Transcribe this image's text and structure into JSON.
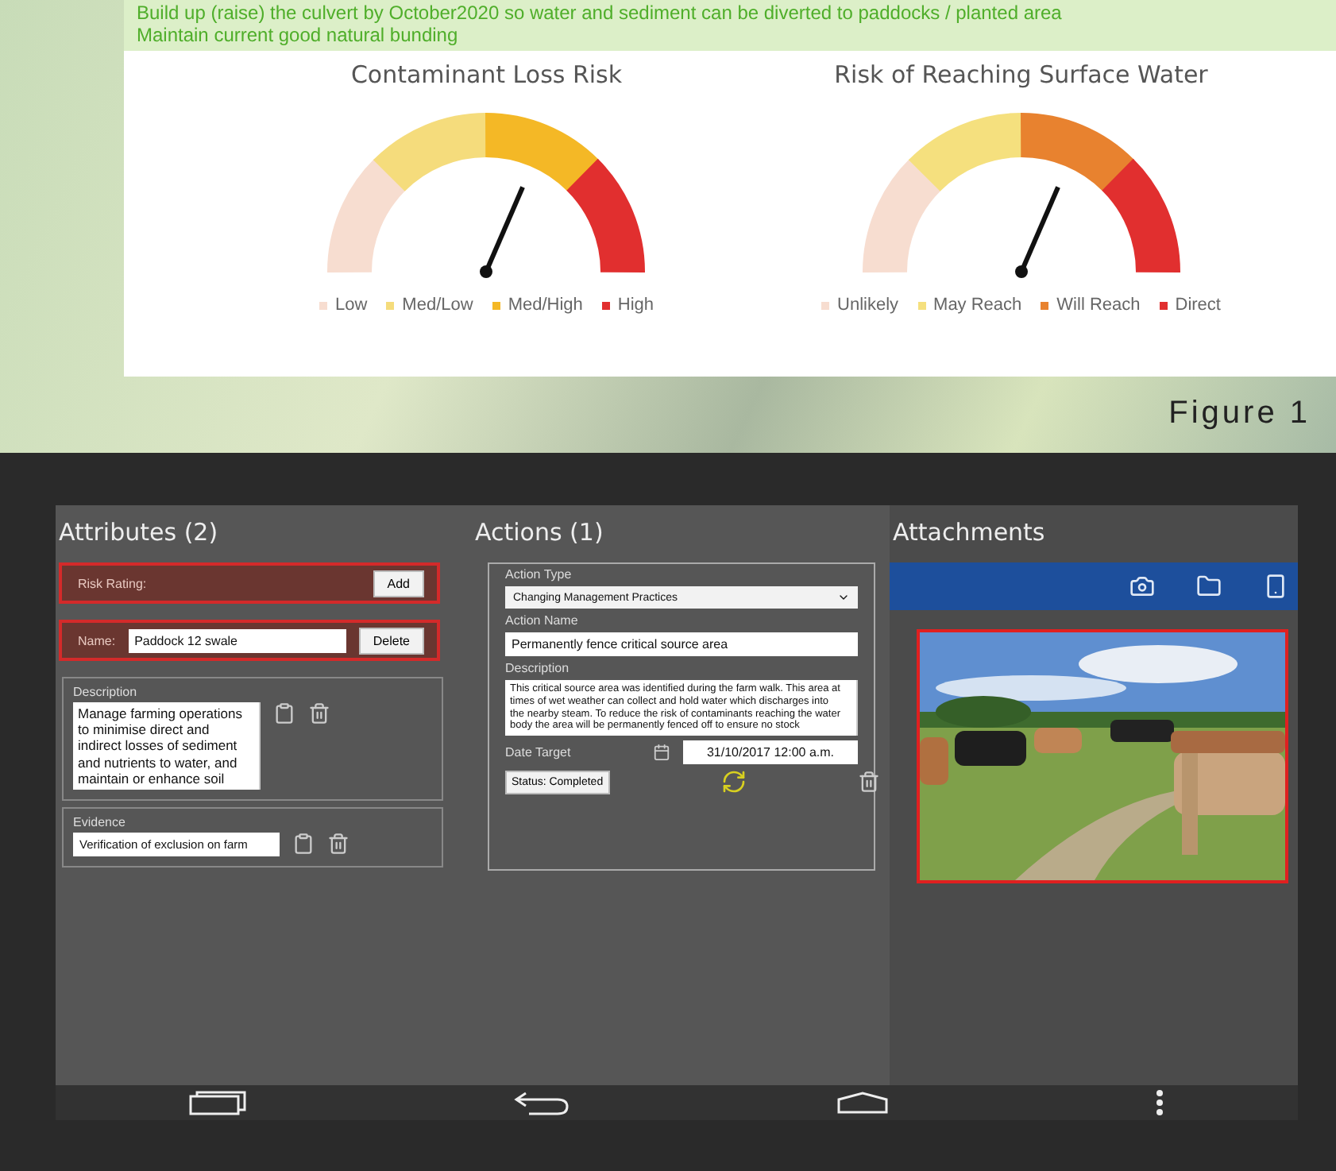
{
  "note": {
    "lines": [
      "Build up (raise) the culvert by October2020 so water and sediment can be diverted to paddocks / planted area",
      "Maintain current good natural bunding"
    ]
  },
  "gauges": [
    {
      "title": "Contaminant Loss Risk",
      "legend": [
        {
          "label": "Low",
          "color": "#f7ddd0"
        },
        {
          "label": "Med/Low",
          "color": "#f5dc7c"
        },
        {
          "label": "Med/High",
          "color": "#f4b826"
        },
        {
          "label": "High",
          "color": "#e12f2f"
        }
      ]
    },
    {
      "title": "Risk of Reaching Surface Water",
      "legend": [
        {
          "label": "Unlikely",
          "color": "#f7ddd0"
        },
        {
          "label": "May Reach",
          "color": "#f5e07e"
        },
        {
          "label": "Will Reach",
          "color": "#e8822f"
        },
        {
          "label": "Direct",
          "color": "#e12f2f"
        }
      ]
    }
  ],
  "caption": "Figure 1",
  "attributes": {
    "title": "Attributes (2)",
    "risk_rating": {
      "label": "Risk Rating:",
      "button": "Add"
    },
    "name": {
      "label": "Name:",
      "value": "Paddock 12 swale",
      "button": "Delete"
    },
    "description": {
      "label": "Description",
      "value": "Manage farming operations to minimise direct and indirect losses of sediment and nutrients to water, and maintain or enhance soil"
    },
    "evidence": {
      "label": "Evidence",
      "value": "Verification of exclusion on farm"
    }
  },
  "actions": {
    "title": "Actions (1)",
    "action_type": {
      "label": "Action Type",
      "value": "Changing Management Practices"
    },
    "action_name": {
      "label": "Action Name",
      "value": "Permanently fence critical source area"
    },
    "description": {
      "label": "Description",
      "value": "This critical source area was identified during the farm walk. This area at times of wet weather can collect and hold water which discharges into the nearby steam. To reduce the risk of contaminants reaching the water body the area will be permanently fenced off to ensure no stock"
    },
    "date_target": {
      "label": "Date Target",
      "value": "31/10/2017 12:00 a.m."
    },
    "status": "Status: Completed"
  },
  "attachments": {
    "title": "Attachments"
  }
}
